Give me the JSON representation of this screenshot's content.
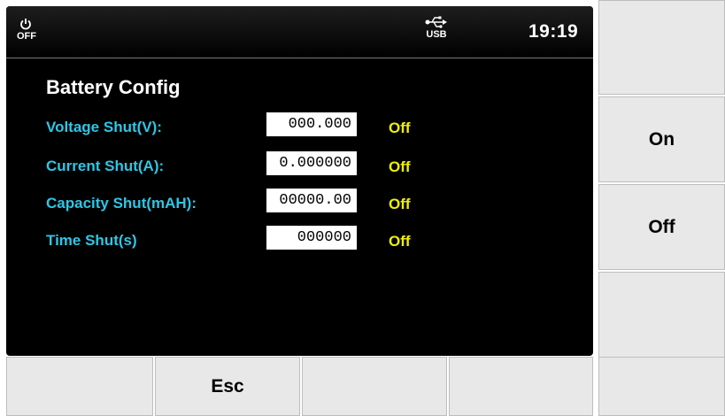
{
  "status": {
    "power_label": "OFF",
    "usb_label": "USB",
    "time": "19:19"
  },
  "title": "Battery Config",
  "rows": [
    {
      "label": "Voltage Shut(V):",
      "value": "000.000",
      "state": "Off"
    },
    {
      "label": "Current Shut(A):",
      "value": "0.000000",
      "state": "Off"
    },
    {
      "label": "Capacity Shut(mAH):",
      "value": "00000.00",
      "state": "Off"
    },
    {
      "label": "Time Shut(s)",
      "value": "000000",
      "state": "Off"
    }
  ],
  "side_keys": [
    "",
    "On",
    "Off",
    "",
    ""
  ],
  "bottom_keys": [
    "",
    "Esc",
    "",
    ""
  ],
  "colors": {
    "label": "#2ec6e6",
    "state": "#f0f000",
    "screen": "#000000",
    "softkey": "#e8e8e8"
  },
  "icons": [
    "power-icon",
    "usb-icon"
  ]
}
